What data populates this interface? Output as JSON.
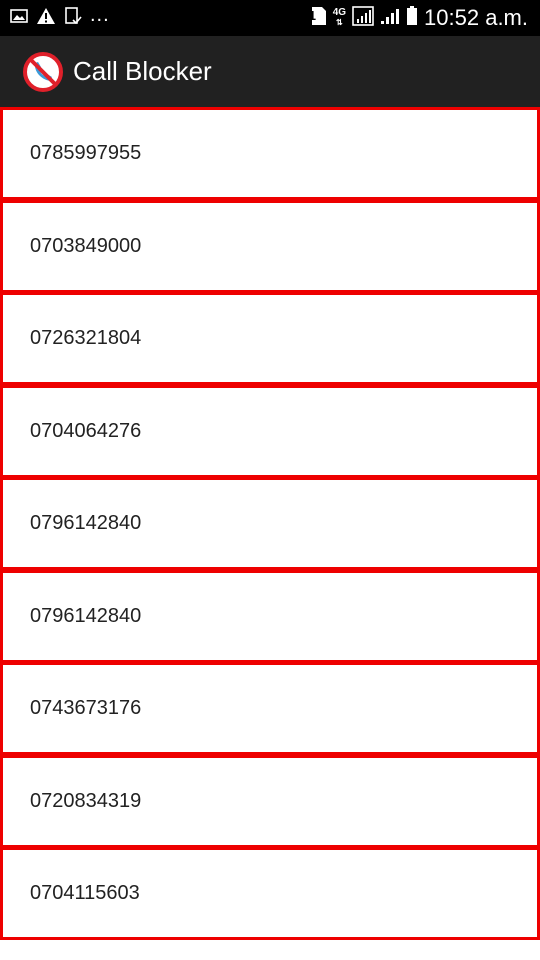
{
  "status_bar": {
    "time": "10:52 a.m.",
    "dots": "...",
    "sim_slot": "1",
    "network_type": "4G",
    "icons": [
      "gallery-icon",
      "warning-icon",
      "clipboard-icon",
      "sim-icon",
      "signal-icon",
      "battery-icon"
    ]
  },
  "app_bar": {
    "title": "Call Blocker",
    "logo_icon": "blocked-call-icon"
  },
  "blocked_numbers": [
    "0785997955",
    "0703849000",
    "0726321804",
    "0704064276",
    "0796142840",
    "0796142840",
    "0743673176",
    "0720834319",
    "0704115603"
  ],
  "colors": {
    "status_bar_bg": "#000000",
    "app_bar_bg": "#212121",
    "item_border": "#ee0000",
    "logo_red": "#e0202a",
    "logo_blue": "#3a9ad9"
  }
}
